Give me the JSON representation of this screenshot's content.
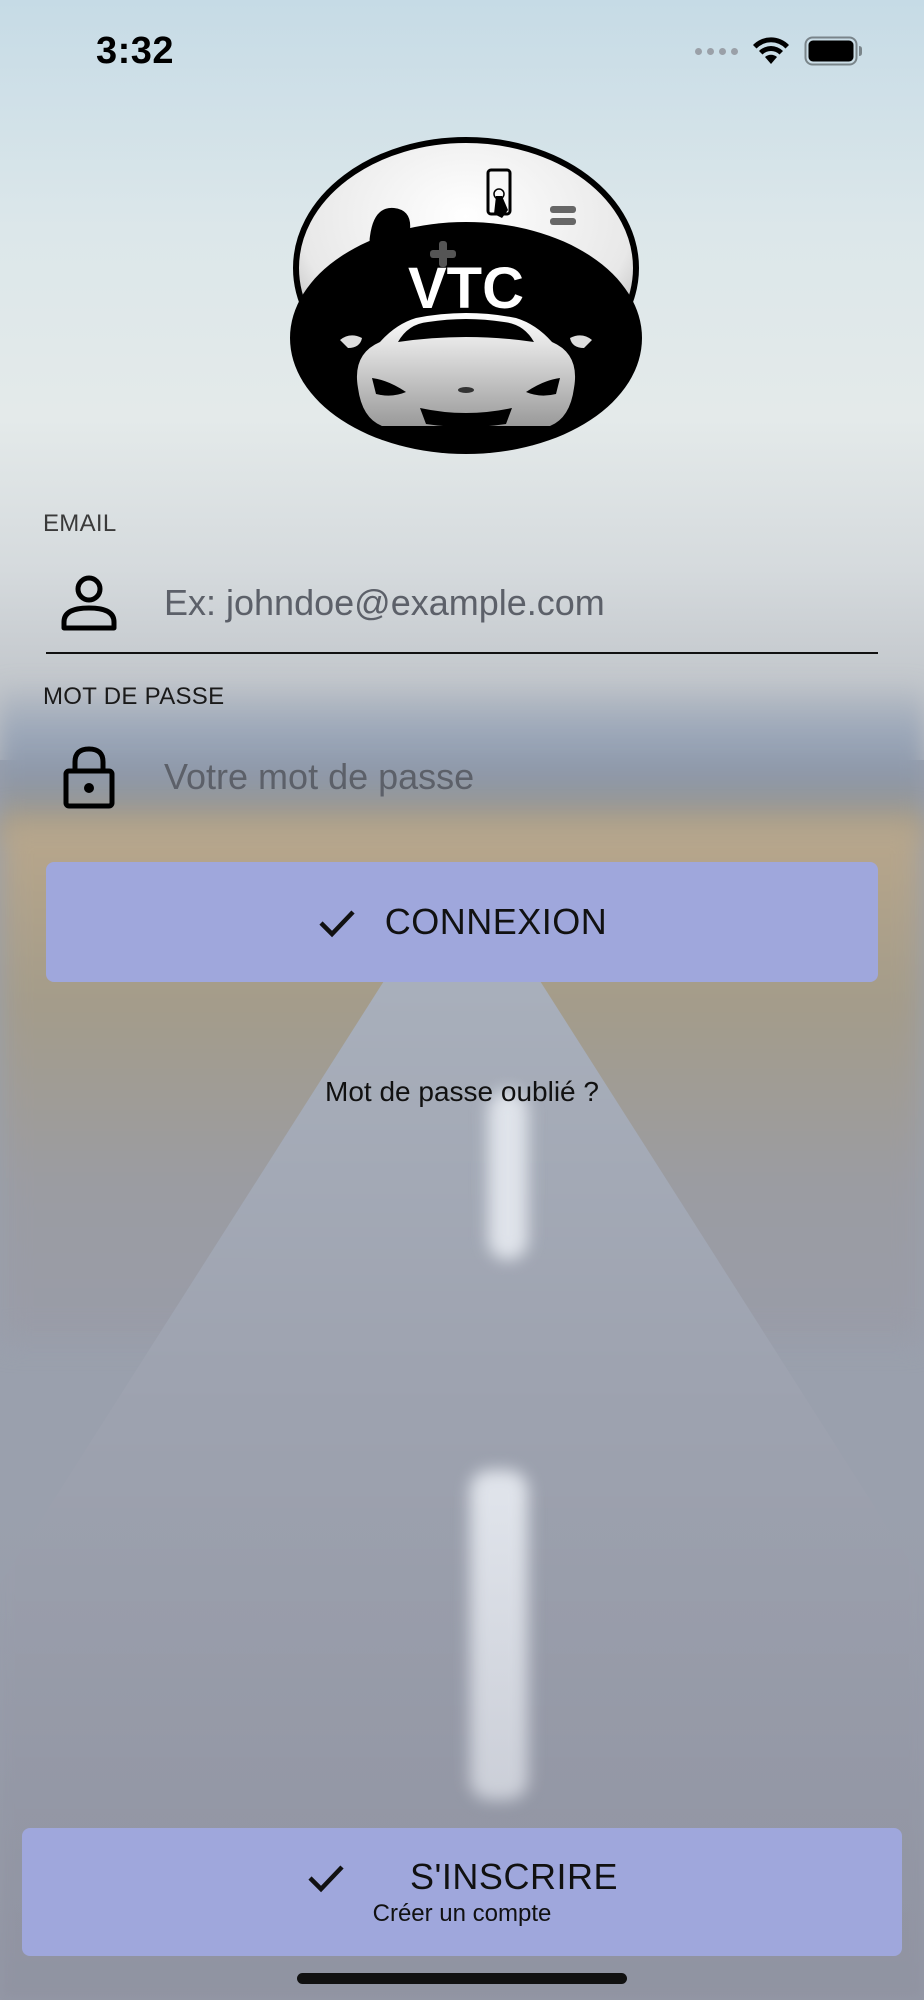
{
  "status_bar": {
    "time": "3:32"
  },
  "logo": {
    "text": "VTC"
  },
  "email": {
    "label": "EMAIL",
    "placeholder": "Ex: johndoe@example.com",
    "value": ""
  },
  "password": {
    "label": "MOT DE PASSE",
    "placeholder": "Votre mot de passe",
    "value": ""
  },
  "login_button": {
    "label": "CONNEXION"
  },
  "forgot_password": {
    "label": "Mot de passe oublié ?"
  },
  "signup_button": {
    "label": "S'INSCRIRE",
    "sublabel": "Créer un compte"
  },
  "colors": {
    "button_bg": "#9fa7dc",
    "text": "#111111",
    "placeholder": "#5c6069"
  }
}
